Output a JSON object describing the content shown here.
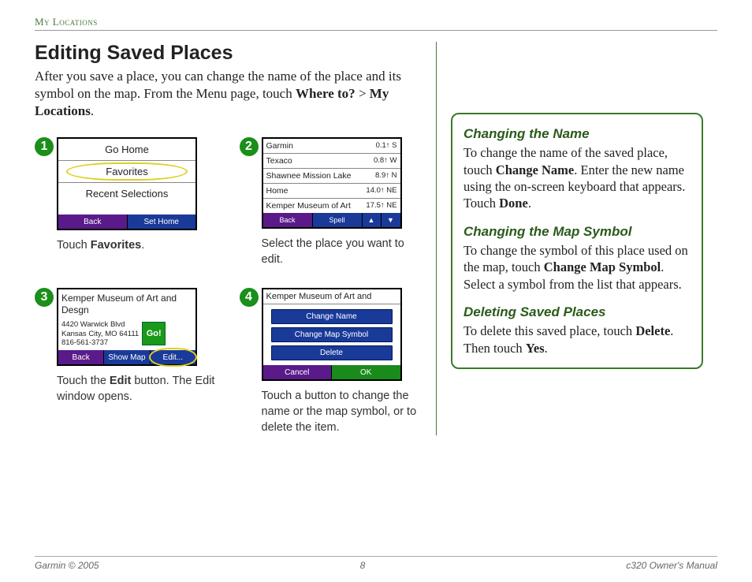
{
  "header": {
    "section": "My Locations"
  },
  "title": "Editing Saved Places",
  "intro": {
    "pre": "After you save a place, you can change the name of the place and its symbol on the map. From the Menu page, touch ",
    "bold1": "Where to?",
    "mid": " > ",
    "bold2": "My Locations",
    "post": "."
  },
  "steps": [
    {
      "num": "1",
      "caption_pre": "Touch ",
      "caption_bold": "Favorites",
      "caption_post": ".",
      "screen": {
        "rows": [
          "Go Home",
          "Favorites",
          "Recent Selections"
        ],
        "highlight_index": 1,
        "footer": [
          {
            "label": "Back",
            "style": "purple"
          },
          {
            "label": "Set Home",
            "style": "blue"
          }
        ]
      }
    },
    {
      "num": "2",
      "caption_pre": "Select the place you want to edit.",
      "caption_bold": "",
      "caption_post": "",
      "screen": {
        "list": [
          {
            "name": "Garmin",
            "dist": "0.1↑ S"
          },
          {
            "name": "Texaco",
            "dist": "0.8↑ W"
          },
          {
            "name": "Shawnee Mission Lake",
            "dist": "8.9↑ N"
          },
          {
            "name": "Home",
            "dist": "14.0↑ NE"
          },
          {
            "name": "Kemper Museum of Art",
            "dist": "17.5↑ NE"
          }
        ],
        "footer": [
          {
            "label": "Back",
            "style": "purple"
          },
          {
            "label": "Spell",
            "style": "blue"
          }
        ],
        "arrows": [
          "▲",
          "▼"
        ]
      }
    },
    {
      "num": "3",
      "caption_pre": "Touch the ",
      "caption_bold": "Edit",
      "caption_post": " button. The Edit window opens.",
      "screen": {
        "title": "Kemper Museum of Art and Desgn",
        "addr": [
          "4420 Warwick Blvd",
          "Kansas City, MO 64111",
          "816-561-3737"
        ],
        "go": "Go!",
        "footer": [
          {
            "label": "Back",
            "style": "purple"
          },
          {
            "label": "Show Map",
            "style": "blue"
          },
          {
            "label": "Edit...",
            "style": "blue",
            "highlight": true
          }
        ]
      }
    },
    {
      "num": "4",
      "caption_pre": "Touch a button to change the name or the map symbol, or to delete the item.",
      "caption_bold": "",
      "caption_post": "",
      "screen": {
        "title": "Kemper Museum of Art and",
        "buttons": [
          "Change Name",
          "Change Map Symbol",
          "Delete"
        ],
        "footer": [
          {
            "label": "Cancel",
            "style": "purple"
          },
          {
            "label": "OK",
            "style": "green"
          }
        ]
      }
    }
  ],
  "sidebar": {
    "s1": {
      "h": "Changing the Name",
      "t1": "To change the name of the saved place, touch ",
      "b1": "Change Name",
      "t2": ". Enter the new name using the on-screen keyboard that appears. Touch ",
      "b2": "Done",
      "t3": "."
    },
    "s2": {
      "h": "Changing the Map Symbol",
      "t1": "To change the symbol of this place used on the map, touch ",
      "b1": "Change Map Symbol",
      "t2": ". Select a symbol from the list that appears."
    },
    "s3": {
      "h": "Deleting Saved Places",
      "t1": "To delete this saved place, touch ",
      "b1": "Delete",
      "t2": ". Then touch ",
      "b2": "Yes",
      "t3": "."
    }
  },
  "footer": {
    "left": "Garmin © 2005",
    "center": "8",
    "right": "c320 Owner's Manual"
  }
}
